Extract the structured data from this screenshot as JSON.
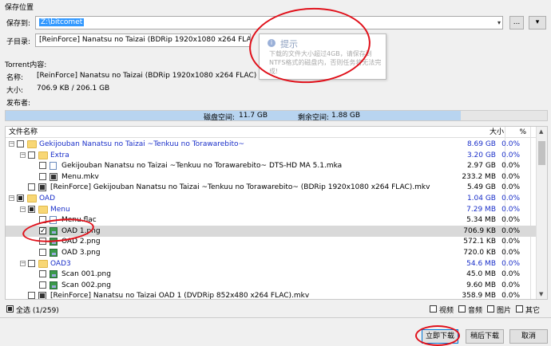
{
  "save_section": {
    "title": "保存位置",
    "save_to_label": "保存到:",
    "save_path": "Z:\\bitcomet",
    "browse_label": "...",
    "dropdown_label": "▾",
    "subdir_label": "子目录:",
    "subdir_value": "[ReinForce] Nanatsu no Taizai (BDRip 1920x1080 x264 FLAC)"
  },
  "tooltip": {
    "title": "提示",
    "body": "下载的文件大小超过4GB，请保存到NTFS格式的磁盘内，否则任务将无法完成!"
  },
  "torrent": {
    "section_title": "Torrent内容:",
    "name_label": "名称:",
    "name_value": "[ReinForce] Nanatsu no Taizai (BDRip 1920x1080 x264 FLAC)",
    "size_label": "大小:",
    "size_value": "706.9 KB / 206.1 GB",
    "publisher_label": "发布者:",
    "publisher_value": ""
  },
  "disk_bar": {
    "disk_space_label": "磁盘空间:",
    "disk_space_value": "11.7 GB",
    "free_space_label": "剩余空间:",
    "free_space_value": "1.88 GB",
    "used_fraction": 0.84
  },
  "table": {
    "col_name": "文件名称",
    "col_size": "大小",
    "col_pct": "%",
    "rows": [
      {
        "name": "Gekijouban Nanatsu no Taizai ~Tenkuu no Torawarebito~",
        "size": "8.69 GB",
        "pct": "0.0%"
      },
      {
        "name": "Extra",
        "size": "3.20 GB",
        "pct": "0.0%"
      },
      {
        "name": "Gekijouban Nanatsu no Taizai ~Tenkuu no Torawarebito~ DTS-HD MA 5.1.mka",
        "size": "2.97 GB",
        "pct": "0.0%"
      },
      {
        "name": "Menu.mkv",
        "size": "233.2 MB",
        "pct": "0.0%"
      },
      {
        "name": "[ReinForce] Gekijouban Nanatsu no Taizai ~Tenkuu no Torawarebito~ (BDRip 1920x1080 x264 FLAC).mkv",
        "size": "5.49 GB",
        "pct": "0.0%"
      },
      {
        "name": "OAD",
        "size": "1.04 GB",
        "pct": "0.0%"
      },
      {
        "name": "Menu",
        "size": "7.29 MB",
        "pct": "0.0%"
      },
      {
        "name": "Menu.flac",
        "size": "5.34 MB",
        "pct": "0.0%"
      },
      {
        "name": "OAD 1.png",
        "size": "706.9 KB",
        "pct": "0.0%"
      },
      {
        "name": "OAD 2.png",
        "size": "572.1 KB",
        "pct": "0.0%"
      },
      {
        "name": "OAD 3.png",
        "size": "720.0 KB",
        "pct": "0.0%"
      },
      {
        "name": "OAD3",
        "size": "54.6 MB",
        "pct": "0.0%"
      },
      {
        "name": "Scan 001.png",
        "size": "45.0 MB",
        "pct": "0.0%"
      },
      {
        "name": "Scan 002.png",
        "size": "9.60 MB",
        "pct": "0.0%"
      },
      {
        "name": "[ReinForce] Nanatsu no Taizai OAD 1 (DVDRip 852x480 x264 FLAC).mkv",
        "size": "358.9 MB",
        "pct": "0.0%"
      }
    ]
  },
  "footer": {
    "select_all": "全选 (1/259)",
    "filter_video": "视频",
    "filter_audio": "音频",
    "filter_image": "图片",
    "filter_other": "其它",
    "download_now": "立即下载",
    "download_later": "稍后下载",
    "cancel": "取消"
  }
}
